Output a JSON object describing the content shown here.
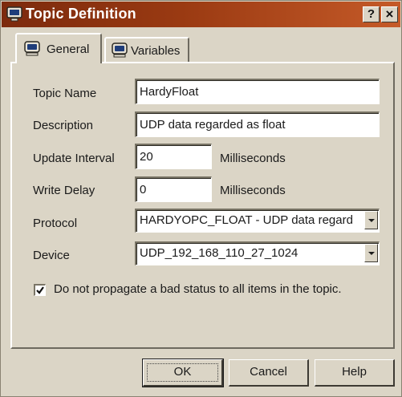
{
  "window": {
    "title": "Topic Definition",
    "help_btn": "?",
    "close_btn": "×"
  },
  "tabs": [
    {
      "label": "General",
      "selected": true
    },
    {
      "label": "Variables",
      "selected": false
    }
  ],
  "form": {
    "topic_name": {
      "label": "Topic Name",
      "value": "HardyFloat"
    },
    "description": {
      "label": "Description",
      "value": "UDP data regarded as float"
    },
    "update_interval": {
      "label": "Update Interval",
      "value": "20",
      "unit": "Milliseconds"
    },
    "write_delay": {
      "label": "Write Delay",
      "value": "0",
      "unit": "Milliseconds"
    },
    "protocol": {
      "label": "Protocol",
      "value": "HARDYOPC_FLOAT - UDP data regard"
    },
    "device": {
      "label": "Device",
      "value": "UDP_192_168_110_27_1024"
    },
    "propagate": {
      "label": "Do not propagate a bad status to all items in the topic.",
      "checked": true
    }
  },
  "buttons": {
    "ok": "OK",
    "cancel": "Cancel",
    "help": "Help"
  },
  "colors": {
    "titlebar_start": "#7c2a0d",
    "titlebar_end": "#c55a28",
    "face": "#dbd5c6"
  }
}
